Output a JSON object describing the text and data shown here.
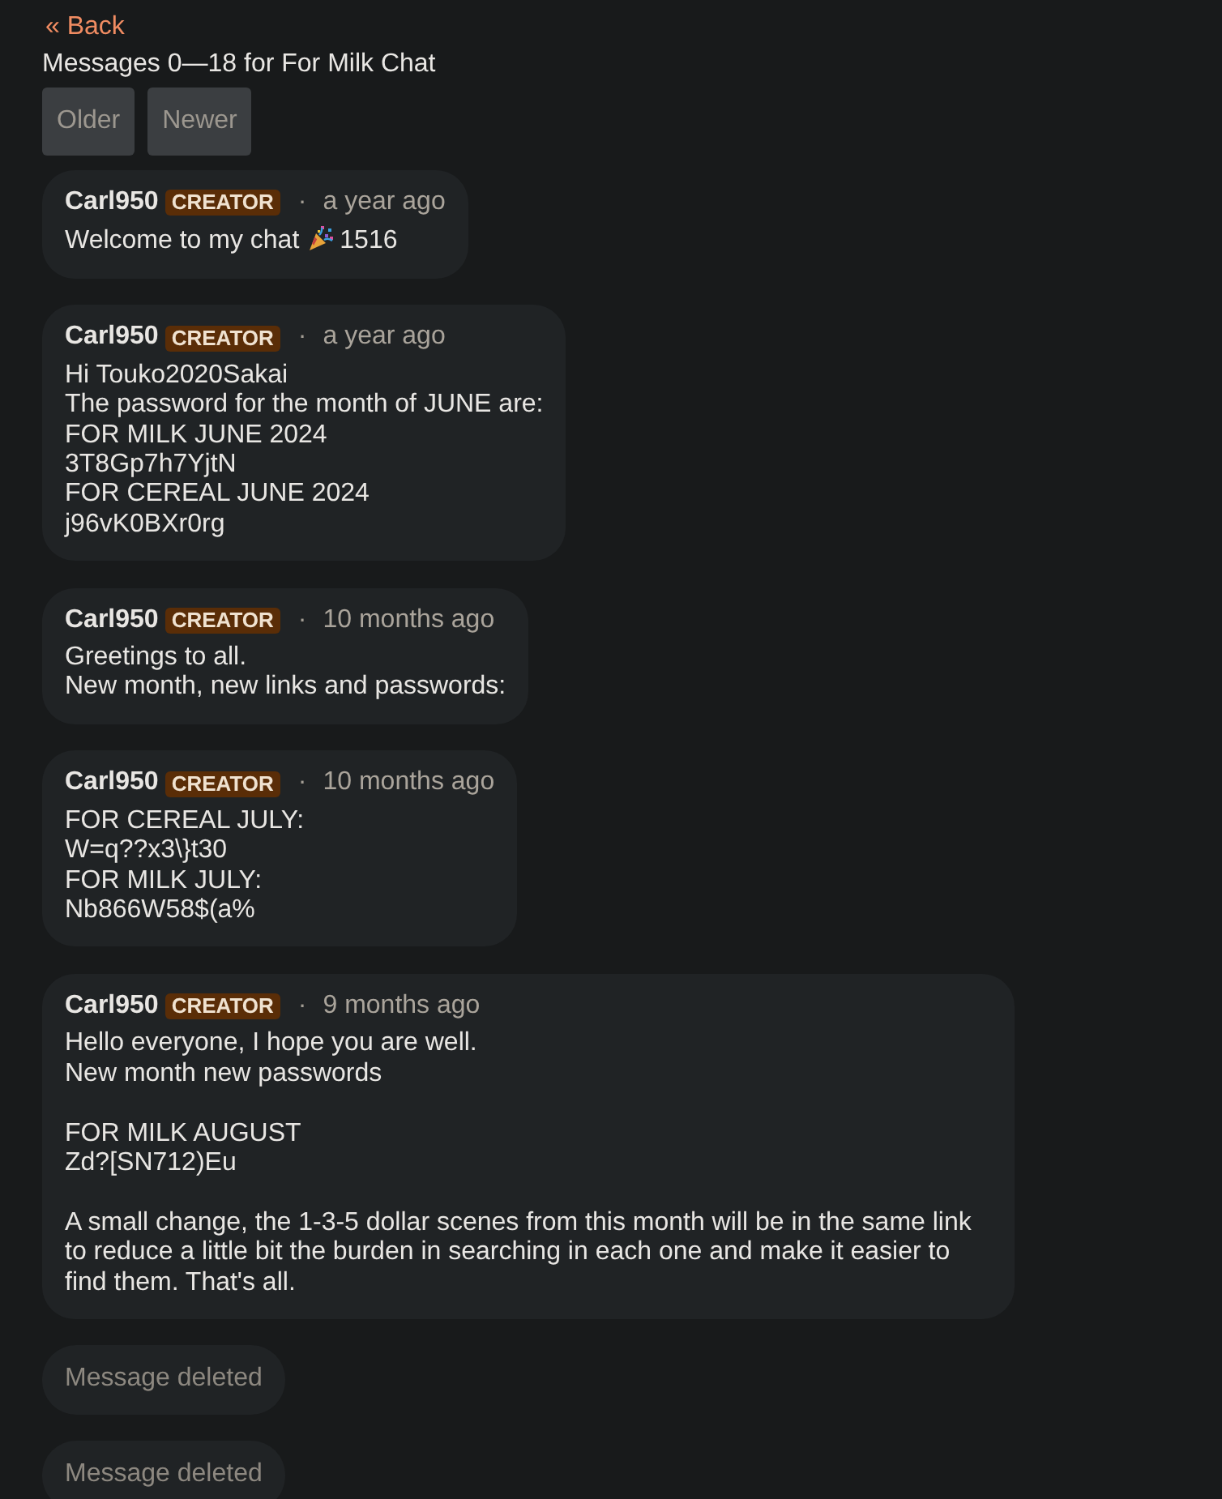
{
  "back_link": {
    "label": "« Back"
  },
  "title": "Messages 0—18 for For Milk Chat",
  "pager_buttons": [
    {
      "label": "Older"
    },
    {
      "label": "Newer"
    }
  ],
  "messages": [
    {
      "kind": "message",
      "author": "Carl950",
      "badge": "CREATOR",
      "separator": "·",
      "time": "a year ago",
      "body": [
        {
          "kind": "text",
          "text": "Welcome to my chat"
        },
        {
          "kind": "icon"
        },
        {
          "kind": "text",
          "text": "1516"
        }
      ]
    },
    {
      "kind": "message",
      "author": "Carl950",
      "badge": "CREATOR",
      "separator": "·",
      "time": "a year ago",
      "body": [
        {
          "kind": "text",
          "text": "Hi Touko2020Sakai\nThe password for the month of JUNE are:\nFOR MILK JUNE 2024\n3T8Gp7h7YjtN\nFOR CEREAL JUNE 2024\nj96vK0BXr0rg"
        }
      ]
    },
    {
      "kind": "message",
      "author": "Carl950",
      "badge": "CREATOR",
      "separator": "·",
      "time": "10 months ago",
      "body": [
        {
          "kind": "text",
          "text": "Greetings to all.\nNew month, new links and passwords:"
        }
      ]
    },
    {
      "kind": "message",
      "author": "Carl950",
      "badge": "CREATOR",
      "separator": "·",
      "time": "10 months ago",
      "body": [
        {
          "kind": "text",
          "text": "FOR CEREAL JULY:\nW=q??x3\\}t30\nFOR MILK JULY:\nNb866W58$(a%"
        }
      ]
    },
    {
      "kind": "message",
      "author": "Carl950",
      "badge": "CREATOR",
      "separator": "·",
      "time": "9 months ago",
      "body": [
        {
          "kind": "text",
          "text": "Hello everyone, I hope you are well.\nNew month new passwords\n\nFOR MILK AUGUST\nZd?[SN712)Eu\n\nA small change, the 1-3-5 dollar scenes from this month will be in the same link to reduce a little bit the burden in searching in each one and make it easier to find them. That's all."
        }
      ]
    },
    {
      "kind": "deleted",
      "text": "Message deleted"
    },
    {
      "kind": "deleted",
      "text": "Message deleted"
    }
  ]
}
